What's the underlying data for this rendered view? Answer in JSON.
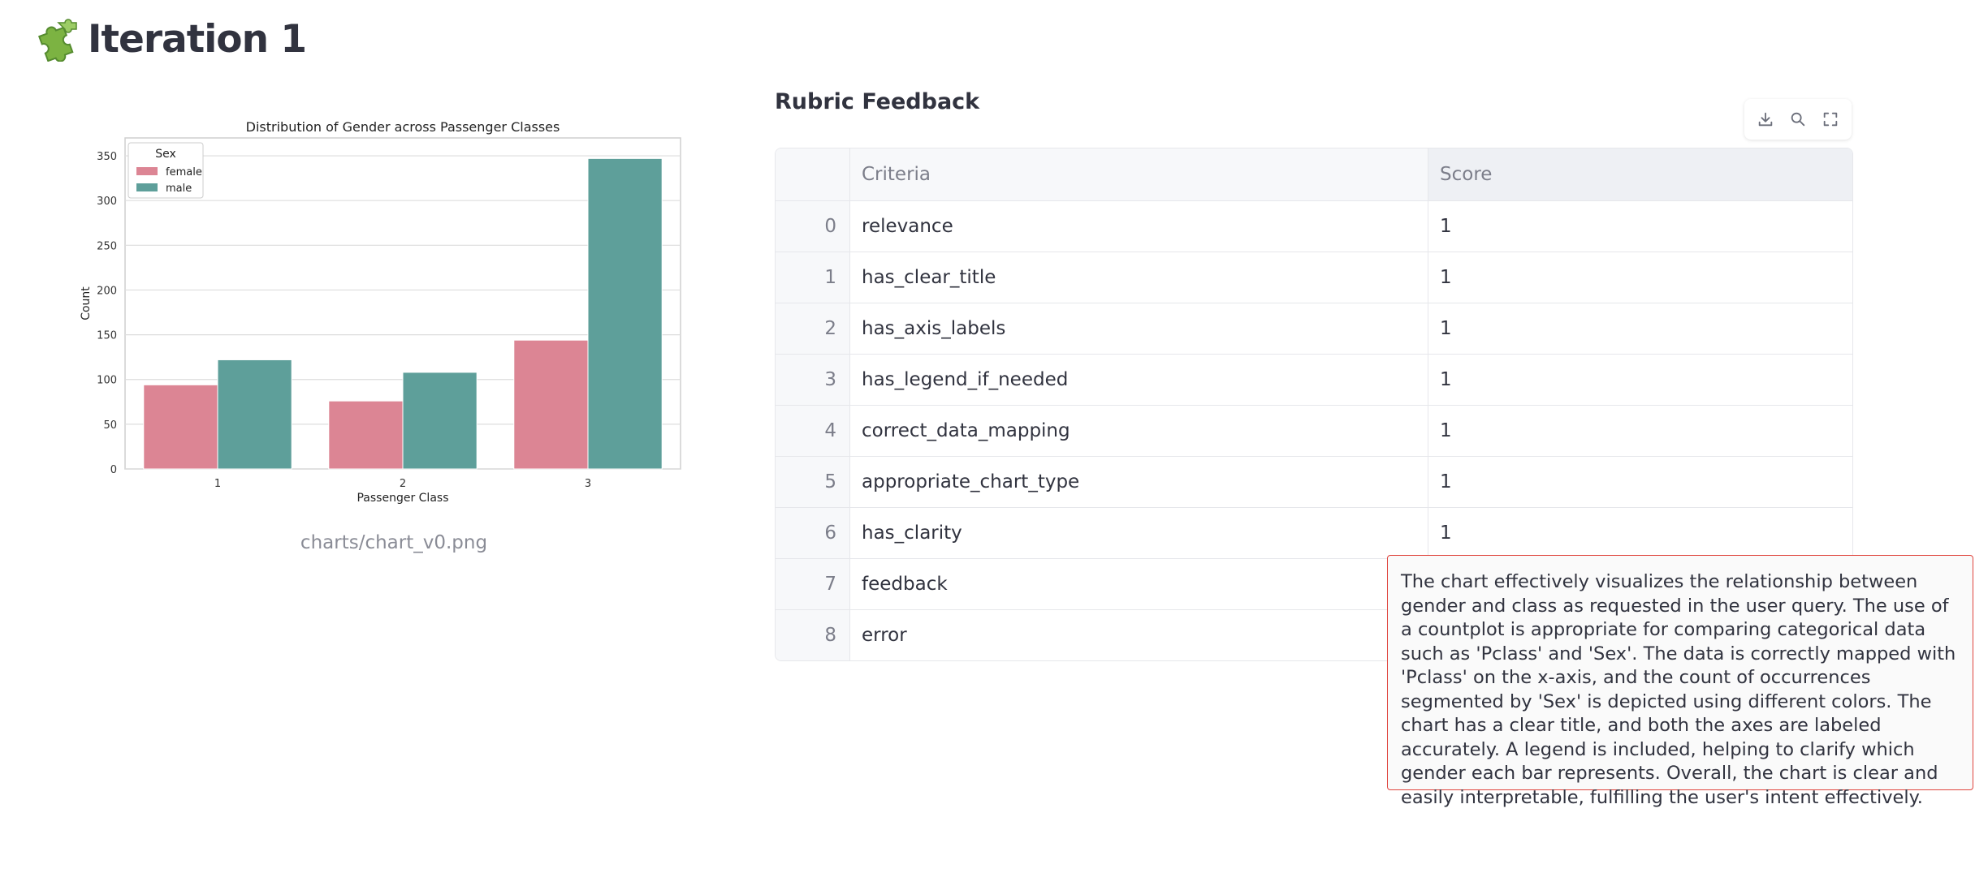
{
  "page": {
    "title": "Iteration 1",
    "title_icon": "puzzle-piece-icon"
  },
  "chart_caption": "charts/chart_v0.png",
  "chart_data": {
    "type": "bar",
    "title": "Distribution of Gender across Passenger Classes",
    "xlabel": "Passenger Class",
    "ylabel": "Count",
    "categories": [
      "1",
      "2",
      "3"
    ],
    "series": [
      {
        "name": "female",
        "values": [
          94,
          76,
          144
        ],
        "color": "#dc8594"
      },
      {
        "name": "male",
        "values": [
          122,
          108,
          347
        ],
        "color": "#5e9f9a"
      }
    ],
    "ylim": [
      0,
      370
    ],
    "yticks": [
      0,
      50,
      100,
      150,
      200,
      250,
      300,
      350
    ],
    "legend": {
      "title": "Sex",
      "placement": "top-left"
    },
    "grid": true
  },
  "panel": {
    "title": "Rubric Feedback",
    "toolbar": {
      "download_icon": "download-icon",
      "search_icon": "search-icon",
      "fullscreen_icon": "fullscreen-icon"
    },
    "columns": [
      "",
      "Criteria",
      "Score"
    ],
    "rows": [
      {
        "index": "0",
        "criteria": "relevance",
        "score": "1"
      },
      {
        "index": "1",
        "criteria": "has_clear_title",
        "score": "1"
      },
      {
        "index": "2",
        "criteria": "has_axis_labels",
        "score": "1"
      },
      {
        "index": "3",
        "criteria": "has_legend_if_needed",
        "score": "1"
      },
      {
        "index": "4",
        "criteria": "correct_data_mapping",
        "score": "1"
      },
      {
        "index": "5",
        "criteria": "appropriate_chart_type",
        "score": "1"
      },
      {
        "index": "6",
        "criteria": "has_clarity",
        "score": "1"
      },
      {
        "index": "7",
        "criteria": "feedback",
        "score": ""
      },
      {
        "index": "8",
        "criteria": "error",
        "score": ""
      }
    ],
    "tooltip": "The chart effectively visualizes the relationship between gender and class as requested in the user query. The use of a countplot is appropriate for comparing categorical data such as 'Pclass' and 'Sex'. The data is correctly mapped with 'Pclass' on the x-axis, and the count of occurrences segmented by 'Sex' is depicted using different colors. The chart has a clear title, and both the axes are labeled accurately. A legend is included, helping to clarify which gender each bar represents. Overall, the chart is clear and easily interpretable, fulfilling the user's intent effectively."
  }
}
